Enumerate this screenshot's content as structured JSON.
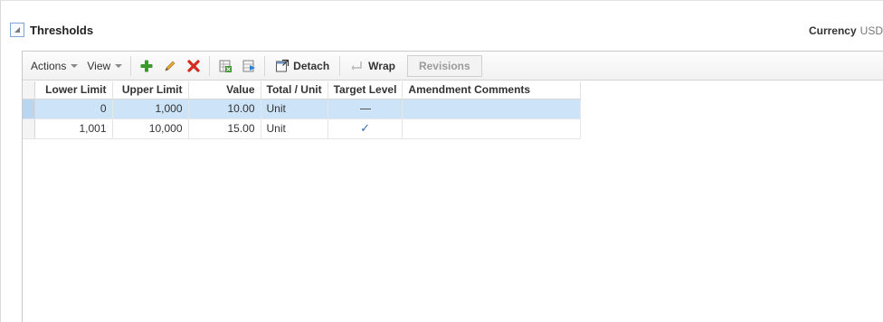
{
  "panel": {
    "title": "Thresholds",
    "currency_label": "Currency",
    "currency_value": "USD"
  },
  "toolbar": {
    "actions_label": "Actions",
    "view_label": "View",
    "detach_label": "Detach",
    "wrap_label": "Wrap",
    "revisions_label": "Revisions"
  },
  "table": {
    "columns": [
      "Lower Limit",
      "Upper Limit",
      "Value",
      "Total / Unit",
      "Target Level",
      "Amendment Comments"
    ],
    "rows": [
      {
        "lower": "0",
        "upper": "1,000",
        "value": "10.00",
        "unit": "Unit",
        "target": "dash",
        "comments": ""
      },
      {
        "lower": "1,001",
        "upper": "10,000",
        "value": "15.00",
        "unit": "Unit",
        "target": "check",
        "comments": ""
      }
    ],
    "target_check_glyph": "✓"
  },
  "icons": {
    "add": "plus-icon",
    "edit": "pencil-icon",
    "delete": "delete-x-icon",
    "export": "export-spreadsheet-icon",
    "freeze": "freeze-icon",
    "detach": "detach-icon",
    "wrap": "wrap-icon"
  },
  "colors": {
    "selected_row": "#cde3f7",
    "add_green": "#3a9a2a",
    "delete_red": "#d22b1f",
    "edit_orange": "#c8891f"
  }
}
